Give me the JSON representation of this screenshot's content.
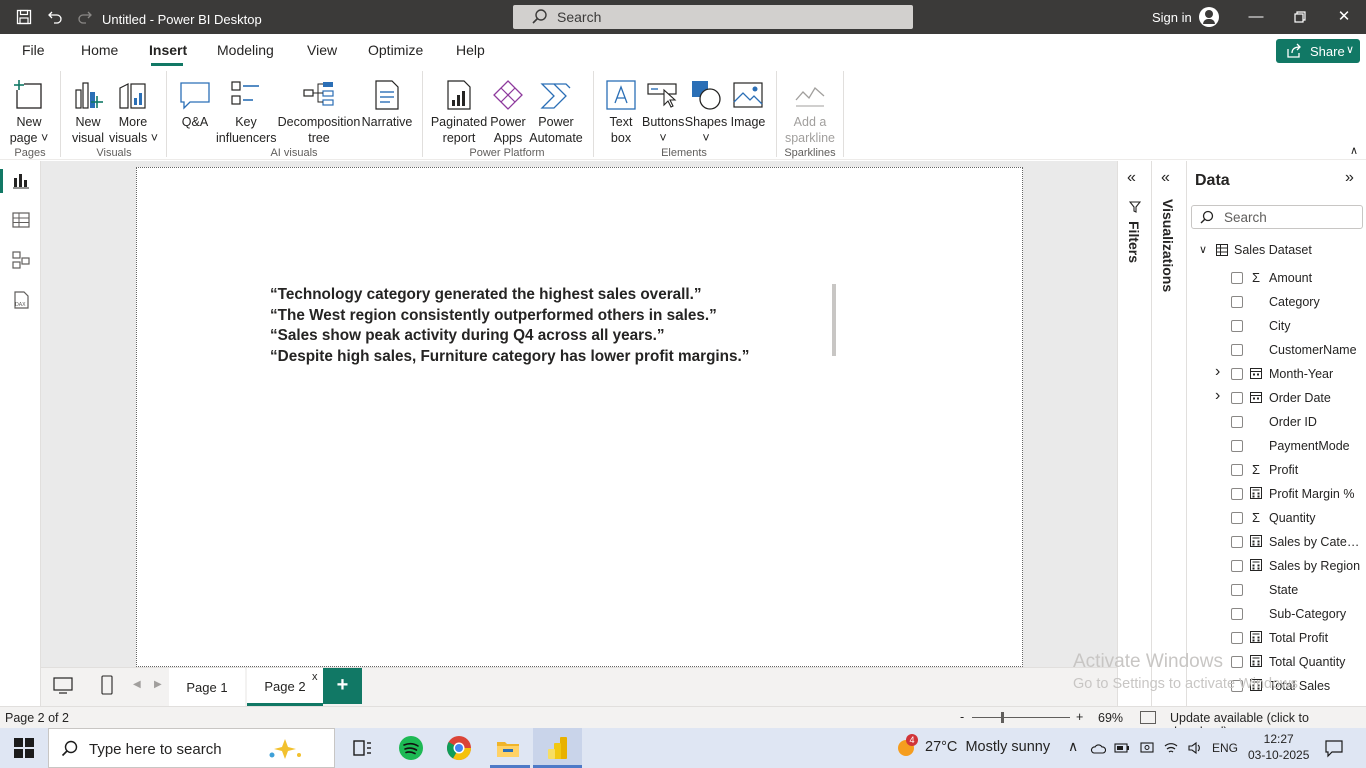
{
  "window": {
    "title": "Untitled - Power BI Desktop",
    "search_label": "Search",
    "sign_in": "Sign in"
  },
  "menu": {
    "tabs": [
      "File",
      "Home",
      "Insert",
      "Modeling",
      "View",
      "Optimize",
      "Help"
    ],
    "active_tab": "Insert",
    "share_label": "Share"
  },
  "ribbon": {
    "new_page": [
      "New",
      "page"
    ],
    "new_visual": [
      "New",
      "visual"
    ],
    "more_visuals": [
      "More",
      "visuals"
    ],
    "qna": "Q&A",
    "key_influencers": [
      "Key",
      "influencers"
    ],
    "decomposition": [
      "Decomposition",
      "tree"
    ],
    "narrative": "Narrative",
    "paginated": [
      "Paginated",
      "report"
    ],
    "power_apps": [
      "Power",
      "Apps"
    ],
    "power_automate": [
      "Power",
      "Automate"
    ],
    "text_box": [
      "Text",
      "box"
    ],
    "buttons": "Buttons",
    "shapes": "Shapes",
    "image": "Image",
    "sparkline": [
      "Add a",
      "sparkline"
    ],
    "groups": {
      "pages": "Pages",
      "visuals": "Visuals",
      "ai_visuals": "AI visuals",
      "power_platform": "Power Platform",
      "elements": "Elements",
      "sparklines": "Sparklines"
    }
  },
  "canvas": {
    "insights": [
      "“Technology category generated the highest sales overall.”",
      "“The West region consistently outperformed others in sales.”",
      "“Sales show peak activity during Q4 across all years.”",
      "“Despite high sales, Furniture category has lower profit margins.”"
    ]
  },
  "panes": {
    "filters_label": "Filters",
    "visualizations_label": "Visualizations",
    "data_title": "Data",
    "data_search_placeholder": "Search",
    "dataset_name": "Sales Dataset",
    "fields": [
      {
        "name": "Amount",
        "icon": "sigma-icon",
        "expandable": false
      },
      {
        "name": "Category",
        "icon": "",
        "expandable": false
      },
      {
        "name": "City",
        "icon": "",
        "expandable": false
      },
      {
        "name": "CustomerName",
        "icon": "",
        "expandable": false
      },
      {
        "name": "Month-Year",
        "icon": "calendar-icon",
        "expandable": true
      },
      {
        "name": "Order Date",
        "icon": "calendar-icon",
        "expandable": true
      },
      {
        "name": "Order ID",
        "icon": "",
        "expandable": false
      },
      {
        "name": "PaymentMode",
        "icon": "",
        "expandable": false
      },
      {
        "name": "Profit",
        "icon": "sigma-icon",
        "expandable": false
      },
      {
        "name": "Profit Margin %",
        "icon": "calculator-icon",
        "expandable": false
      },
      {
        "name": "Quantity",
        "icon": "sigma-icon",
        "expandable": false
      },
      {
        "name": "Sales by Catego...",
        "icon": "calculator-icon",
        "expandable": false
      },
      {
        "name": "Sales by Region",
        "icon": "calculator-icon",
        "expandable": false
      },
      {
        "name": "State",
        "icon": "",
        "expandable": false
      },
      {
        "name": "Sub-Category",
        "icon": "",
        "expandable": false
      },
      {
        "name": "Total Profit",
        "icon": "calculator-icon",
        "expandable": false
      },
      {
        "name": "Total Quantity",
        "icon": "calculator-icon",
        "expandable": false
      },
      {
        "name": "Total Sales",
        "icon": "calculator-icon",
        "expandable": false
      }
    ]
  },
  "pages": {
    "tabs": [
      "Page 1",
      "Page 2"
    ],
    "active": "Page 2",
    "close_glyph": "x",
    "add_glyph": "+"
  },
  "status": {
    "page_of": "Page 2 of 2",
    "zoom_minus": "-",
    "zoom_plus": "+",
    "zoom": "69%",
    "zoom_fraction": 0.3,
    "update": "Update available (click to download)"
  },
  "watermark": {
    "line1": "Activate Windows",
    "line2": "Go to Settings to activate Windows."
  },
  "taskbar": {
    "search_placeholder": "Type here to search",
    "weather_badge": "4",
    "weather": "27°C  Mostly sunny",
    "lang": "ENG",
    "time": "12:27",
    "date": "03-10-2025"
  },
  "colors": {
    "accent": "#117865",
    "titlebar": "#3b3a39",
    "taskbar": "#dfe6f3"
  }
}
